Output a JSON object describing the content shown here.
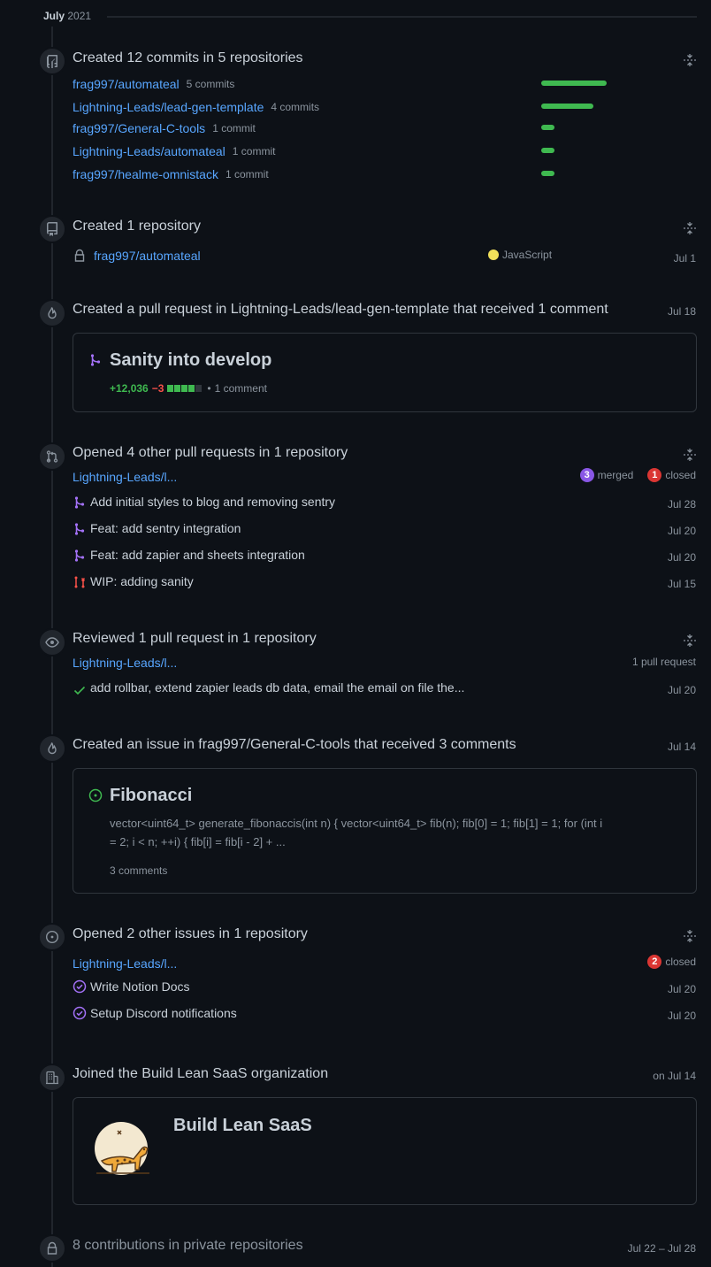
{
  "month": {
    "label_bold": "July",
    "label_year": "2021"
  },
  "commits": {
    "title": "Created 12 commits in 5 repositories",
    "repos": [
      {
        "name": "frag997/automateal",
        "count": "5 commits",
        "bar_fraction": 1.0
      },
      {
        "name": "Lightning-Leads/lead-gen-template",
        "count": "4 commits",
        "bar_fraction": 0.8
      },
      {
        "name": "frag997/General-C-tools",
        "count": "1 commit",
        "bar_fraction": 0.2
      },
      {
        "name": "Lightning-Leads/automateal",
        "count": "1 commit",
        "bar_fraction": 0.2
      },
      {
        "name": "frag997/healme-omnistack",
        "count": "1 commit",
        "bar_fraction": 0.2
      }
    ]
  },
  "repo_created": {
    "title": "Created 1 repository",
    "repo": "frag997/automateal",
    "language": "JavaScript",
    "language_color": "#f1e05a",
    "date": "Jul 1"
  },
  "pr_comment": {
    "title": "Created a pull request in Lightning-Leads/lead-gen-template that received 1 comment",
    "date": "Jul 18",
    "pr_title": "Sanity into develop",
    "additions": "+12,036",
    "deletions": "−3",
    "comments": "1 comment"
  },
  "other_prs": {
    "title": "Opened 4 other pull requests in 1 repository",
    "repo": "Lightning-Leads/l...",
    "merged_count": "3",
    "merged_label": "merged",
    "closed_count": "1",
    "closed_label": "closed",
    "items": [
      {
        "title": "Add initial styles to blog and removing sentry",
        "date": "Jul 28",
        "state": "merged"
      },
      {
        "title": "Feat: add sentry integration",
        "date": "Jul 20",
        "state": "merged"
      },
      {
        "title": "Feat: add zapier and sheets integration",
        "date": "Jul 20",
        "state": "merged"
      },
      {
        "title": "WIP: adding sanity",
        "date": "Jul 15",
        "state": "closed"
      }
    ]
  },
  "reviewed": {
    "title": "Reviewed 1 pull request in 1 repository",
    "repo": "Lightning-Leads/l...",
    "count": "1 pull request",
    "item_title": "add rollbar, extend zapier leads db data, email the email on file the...",
    "date": "Jul 20"
  },
  "issue": {
    "title": "Created an issue in frag997/General-C-tools that received 3 comments",
    "date": "Jul 14",
    "issue_title": "Fibonacci",
    "body_line1": "vector<uint64_t> generate_fibonaccis(int n) { vector<uint64_t> fib(n); fib[0] = 1; fib[1] = 1; for (int i",
    "body_line2": "= 2; i < n; ++i) { fib[i] = fib[i - 2] + ...",
    "comments": "3 comments"
  },
  "other_issues": {
    "title": "Opened 2 other issues in 1 repository",
    "repo": "Lightning-Leads/l...",
    "closed_count": "2",
    "closed_label": "closed",
    "items": [
      {
        "title": "Write Notion Docs",
        "date": "Jul 20"
      },
      {
        "title": "Setup Discord notifications",
        "date": "Jul 20"
      }
    ]
  },
  "org": {
    "title": "Joined the Build Lean SaaS organization",
    "date": "on Jul 14",
    "name": "Build Lean SaaS"
  },
  "private": {
    "title": "8 contributions in private repositories",
    "date_range": "Jul 22 – Jul 28"
  },
  "colors": {
    "merged": "#a371f7",
    "closed": "#f85149",
    "open": "#3fb950",
    "link": "#58a6ff"
  }
}
